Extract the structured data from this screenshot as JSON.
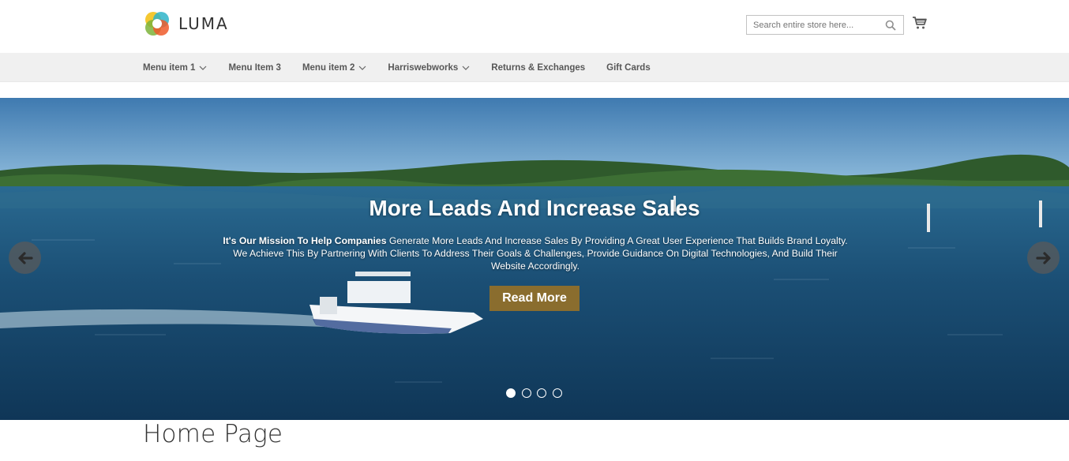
{
  "header": {
    "logo_text": "LUMA",
    "search": {
      "placeholder": "Search entire store here..."
    },
    "icons": {
      "search": "search-icon",
      "cart": "cart-icon"
    }
  },
  "nav": {
    "items": [
      {
        "label": "Menu item 1",
        "has_submenu": true
      },
      {
        "label": "Menu Item 3",
        "has_submenu": false
      },
      {
        "label": "Menu item 2",
        "has_submenu": true
      },
      {
        "label": "Harriswebworks",
        "has_submenu": true
      },
      {
        "label": "Returns & Exchanges",
        "has_submenu": false
      },
      {
        "label": "Gift Cards",
        "has_submenu": false
      }
    ]
  },
  "hero": {
    "title": "More Leads And Increase Sales",
    "text_bold": "It's Our Mission To Help Companies",
    "text_rest": " Generate More Leads And Increase Sales By Providing A Great User Experience That Builds Brand Loyalty. We Achieve This By Partnering With Clients To Address Their Goals & Challenges, Provide Guidance On Digital Technologies, And Build Their Website Accordingly.",
    "button_label": "Read More",
    "slides_total": 4,
    "active_slide": 1,
    "colors": {
      "button": "#8a6d2e",
      "water": "#1a4f72",
      "sky": "#4f86b5"
    }
  },
  "page": {
    "title": "Home Page"
  }
}
